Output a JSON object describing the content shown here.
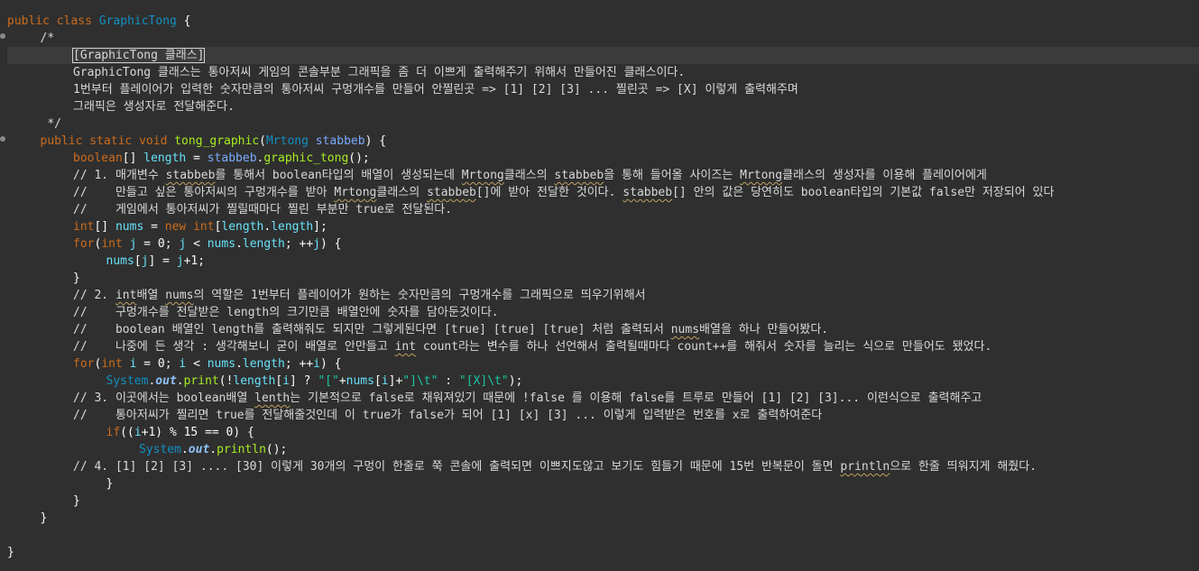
{
  "editor": {
    "lines": [
      {
        "indent": 0,
        "tokens": [
          [
            "kw",
            "public "
          ],
          [
            "kw",
            "class "
          ],
          [
            "cls",
            "GraphicTong"
          ],
          [
            "txt",
            " {"
          ]
        ]
      },
      {
        "indent": 1,
        "tokens": [
          [
            "cmt",
            "/*"
          ]
        ]
      },
      {
        "indent": 2,
        "current": true,
        "tokens": [
          [
            "cmt",
            "[GraphicTong 클래스]"
          ]
        ]
      },
      {
        "indent": 2,
        "tokens": [
          [
            "cmt",
            "GraphicTong 클래스는 통아저씨 게임의 콘솔부분 그래픽을 좀 더 이쁘게 출력해주기 위해서 만들어진 클래스이다."
          ]
        ]
      },
      {
        "indent": 2,
        "tokens": [
          [
            "cmt",
            "1번부터 플레이어가 입력한 숫자만큼의 통아저씨 구멍개수를 만들어 안찔린곳 => [1] [2] [3] ... 찔린곳 => [X] 이렇게 출력해주며"
          ]
        ]
      },
      {
        "indent": 2,
        "tokens": [
          [
            "cmt",
            "그래픽은 생성자로 전달해준다."
          ]
        ]
      },
      {
        "indent": 1,
        "tokens": [
          [
            "cmt",
            " */"
          ]
        ]
      },
      {
        "indent": 1,
        "tokens": [
          [
            "kw",
            "public "
          ],
          [
            "kw",
            "static "
          ],
          [
            "kw",
            "void "
          ],
          [
            "mtd",
            "tong_graphic"
          ],
          [
            "txt",
            "("
          ],
          [
            "cls",
            "Mrtong"
          ],
          [
            "txt",
            " "
          ],
          [
            "par",
            "stabbeb"
          ],
          [
            "txt",
            ") {"
          ]
        ]
      },
      {
        "indent": 2,
        "tokens": [
          [
            "kw",
            "boolean"
          ],
          [
            "txt",
            "[] "
          ],
          [
            "fld",
            "length"
          ],
          [
            "txt",
            " = "
          ],
          [
            "par",
            "stabbeb"
          ],
          [
            "txt",
            "."
          ],
          [
            "mtd",
            "graphic_tong"
          ],
          [
            "txt",
            "();"
          ]
        ]
      },
      {
        "indent": 2,
        "tokens": [
          [
            "cmt",
            "// 1. 매개변수 "
          ],
          [
            "sq",
            "stabbeb"
          ],
          [
            "cmt",
            "를 통해서 boolean타입의 배열이 생성되는데 "
          ],
          [
            "sq",
            "Mrtong"
          ],
          [
            "cmt",
            "클래스의 "
          ],
          [
            "sq",
            "stabbeb"
          ],
          [
            "cmt",
            "을 통해 들어올 사이즈는 "
          ],
          [
            "sq",
            "Mrtong"
          ],
          [
            "cmt",
            "클래스의 생성자를 이용해 플레이어에게"
          ]
        ]
      },
      {
        "indent": 2,
        "tokens": [
          [
            "cmt",
            "//    만들고 싶은 통아저씨의 구멍개수를 받아 "
          ],
          [
            "sq",
            "Mrtong"
          ],
          [
            "cmt",
            "클래스의 "
          ],
          [
            "sq",
            "stabbeb"
          ],
          [
            "cmt",
            "[]에 받아 전달한 것이다. "
          ],
          [
            "sq",
            "stabbeb"
          ],
          [
            "cmt",
            "[] 안의 값은 당연히도 boolean타입의 기본값 false만 저장되어 있다"
          ]
        ]
      },
      {
        "indent": 2,
        "tokens": [
          [
            "cmt",
            "//    게임에서 통아저씨가 찔릴때마다 찔린 부분만 true로 전달된다."
          ]
        ]
      },
      {
        "indent": 2,
        "tokens": [
          [
            "kw",
            "int"
          ],
          [
            "txt",
            "[] "
          ],
          [
            "fld",
            "nums"
          ],
          [
            "txt",
            " = "
          ],
          [
            "kw",
            "new "
          ],
          [
            "kw",
            "int"
          ],
          [
            "txt",
            "["
          ],
          [
            "fld",
            "length"
          ],
          [
            "txt",
            "."
          ],
          [
            "fld",
            "length"
          ],
          [
            "txt",
            "];"
          ]
        ]
      },
      {
        "indent": 2,
        "tokens": [
          [
            "kw",
            "for"
          ],
          [
            "txt",
            "("
          ],
          [
            "kw",
            "int "
          ],
          [
            "fld",
            "j"
          ],
          [
            "txt",
            " = 0; "
          ],
          [
            "fld",
            "j"
          ],
          [
            "txt",
            " < "
          ],
          [
            "fld",
            "nums"
          ],
          [
            "txt",
            "."
          ],
          [
            "fld",
            "length"
          ],
          [
            "txt",
            "; ++"
          ],
          [
            "fld",
            "j"
          ],
          [
            "txt",
            ") {"
          ]
        ]
      },
      {
        "indent": 3,
        "tokens": [
          [
            "fld",
            "nums"
          ],
          [
            "txt",
            "["
          ],
          [
            "fld",
            "j"
          ],
          [
            "txt",
            "] = "
          ],
          [
            "fld",
            "j"
          ],
          [
            "txt",
            "+1;"
          ]
        ]
      },
      {
        "indent": 2,
        "tokens": [
          [
            "txt",
            "}"
          ]
        ]
      },
      {
        "indent": 2,
        "tokens": [
          [
            "cmt",
            "// 2. "
          ],
          [
            "sq",
            "int"
          ],
          [
            "cmt",
            "배열 "
          ],
          [
            "sq",
            "nums"
          ],
          [
            "cmt",
            "의 역할은 1번부터 플레이어가 원하는 숫자만큼의 구멍개수를 그래픽으로 띄우기위해서"
          ]
        ]
      },
      {
        "indent": 2,
        "tokens": [
          [
            "cmt",
            "//    구멍개수를 전달받은 length의 크기만큼 배열안에 숫자를 담아둔것이다."
          ]
        ]
      },
      {
        "indent": 2,
        "tokens": [
          [
            "cmt",
            "//    boolean 배열인 length를 출력해줘도 되지만 그렇게된다면 [true] [true] [true] 처럼 출력되서 "
          ],
          [
            "sq",
            "nums"
          ],
          [
            "cmt",
            "배열을 하나 만들어봤다."
          ]
        ]
      },
      {
        "indent": 2,
        "tokens": [
          [
            "cmt",
            "//    나중에 든 생각 : 생각해보니 굳이 배열로 안만들고 "
          ],
          [
            "sq",
            "int"
          ],
          [
            "cmt",
            " count라는 변수를 하나 선언해서 출력될때마다 count++를 해줘서 숫자를 늘리는 식으로 만들어도 됐었다."
          ]
        ]
      },
      {
        "indent": 2,
        "tokens": [
          [
            "kw",
            "for"
          ],
          [
            "txt",
            "("
          ],
          [
            "kw",
            "int "
          ],
          [
            "fld",
            "i"
          ],
          [
            "txt",
            " = 0; "
          ],
          [
            "fld",
            "i"
          ],
          [
            "txt",
            " < "
          ],
          [
            "fld",
            "nums"
          ],
          [
            "txt",
            "."
          ],
          [
            "fld",
            "length"
          ],
          [
            "txt",
            "; ++"
          ],
          [
            "fld",
            "i"
          ],
          [
            "txt",
            ") {"
          ]
        ]
      },
      {
        "indent": 3,
        "tokens": [
          [
            "cls",
            "System"
          ],
          [
            "txt",
            "."
          ],
          [
            "static-fld",
            "out"
          ],
          [
            "txt",
            "."
          ],
          [
            "mtd",
            "print"
          ],
          [
            "txt",
            "(!"
          ],
          [
            "fld",
            "length"
          ],
          [
            "txt",
            "["
          ],
          [
            "fld",
            "i"
          ],
          [
            "txt",
            "] ? "
          ],
          [
            "str",
            "\"[\""
          ],
          [
            "txt",
            "+"
          ],
          [
            "fld",
            "nums"
          ],
          [
            "txt",
            "["
          ],
          [
            "fld",
            "i"
          ],
          [
            "txt",
            "]+"
          ],
          [
            "str",
            "\"]\\t\""
          ],
          [
            "txt",
            " : "
          ],
          [
            "str",
            "\"[X]\\t\""
          ],
          [
            "txt",
            ");"
          ]
        ]
      },
      {
        "indent": 2,
        "tokens": [
          [
            "cmt",
            "// 3. 이곳에서는 boolean배열 "
          ],
          [
            "sq",
            "lenth"
          ],
          [
            "cmt",
            "는 기본적으로 false로 채워져있기 때문에 !false 를 이용해 false를 트루로 만들어 [1] [2] [3]... 이런식으로 출력해주고"
          ]
        ]
      },
      {
        "indent": 2,
        "tokens": [
          [
            "cmt",
            "//    통아저씨가 찔리면 true를 전달해줄것인데 이 true가 false가 되어 [1] [x] [3] ... 이렇게 입력받은 번호를 x로 출력하여준다"
          ]
        ]
      },
      {
        "indent": 3,
        "tokens": [
          [
            "kw",
            "if"
          ],
          [
            "txt",
            "(("
          ],
          [
            "fld",
            "i"
          ],
          [
            "txt",
            "+1) % 15 == 0) {"
          ]
        ]
      },
      {
        "indent": 4,
        "tokens": [
          [
            "cls",
            "System"
          ],
          [
            "txt",
            "."
          ],
          [
            "static-fld",
            "out"
          ],
          [
            "txt",
            "."
          ],
          [
            "mtd",
            "println"
          ],
          [
            "txt",
            "();"
          ]
        ]
      },
      {
        "indent": 2,
        "tokens": [
          [
            "cmt",
            "// 4. [1] [2] [3] .... [30] 이렇게 30개의 구멍이 한줄로 쭉 콘솔에 출력되면 이쁘지도않고 보기도 힘들기 때문에 15번 반복문이 돌면 "
          ],
          [
            "sq",
            "println"
          ],
          [
            "cmt",
            "으로 한줄 띄워지게 해줬다."
          ]
        ]
      },
      {
        "indent": 3,
        "tokens": [
          [
            "txt",
            "}"
          ]
        ]
      },
      {
        "indent": 2,
        "tokens": [
          [
            "txt",
            "}"
          ]
        ]
      },
      {
        "indent": 1,
        "tokens": [
          [
            "txt",
            "}"
          ]
        ]
      },
      {
        "indent": 0,
        "tokens": [
          [
            "txt",
            ""
          ]
        ]
      },
      {
        "indent": 0,
        "tokens": [
          [
            "txt",
            "}"
          ]
        ]
      }
    ]
  }
}
